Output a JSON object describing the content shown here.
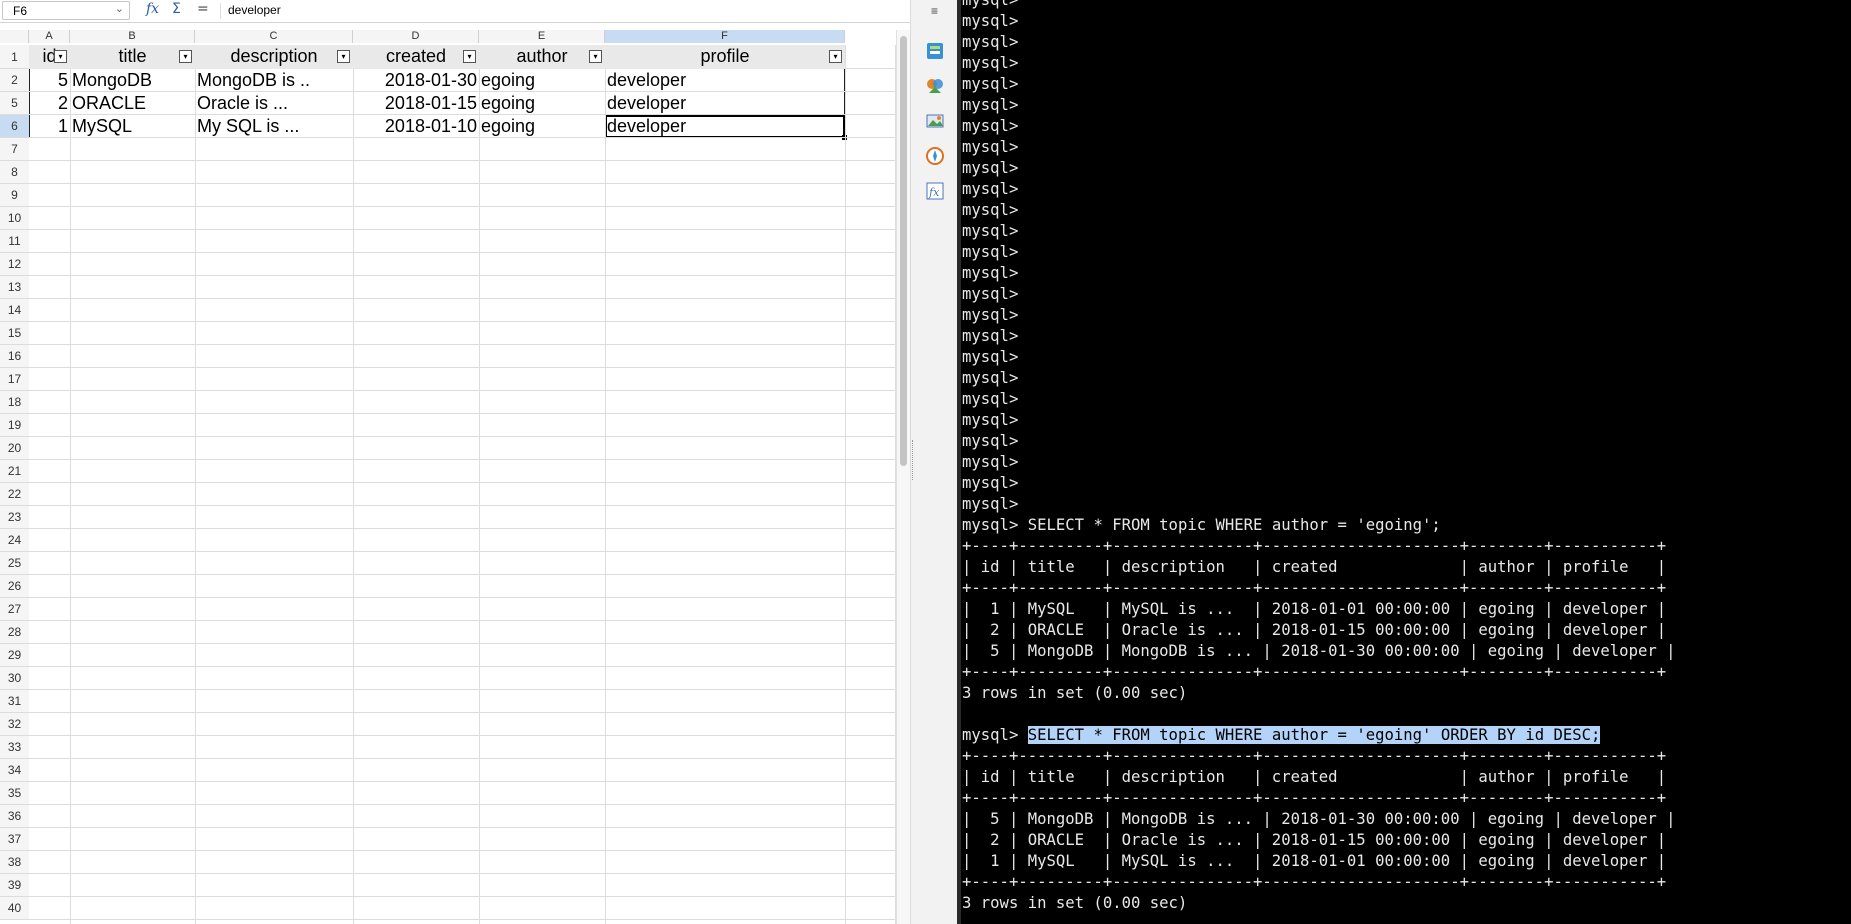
{
  "formula_bar": {
    "cell_ref": "F6",
    "value": "developer",
    "icons": [
      "function-wizard-icon",
      "sum-icon",
      "formula-equals-icon"
    ]
  },
  "columns": [
    "A",
    "B",
    "C",
    "D",
    "E",
    "F"
  ],
  "selected_column": "F",
  "row_numbers": [
    "1",
    "2",
    "5",
    "6",
    "7",
    "8",
    "9",
    "10",
    "11",
    "12",
    "13",
    "14",
    "15",
    "16",
    "17",
    "18",
    "19",
    "20",
    "21",
    "22",
    "23",
    "24",
    "25",
    "26",
    "27",
    "28",
    "29",
    "30",
    "31",
    "32",
    "33",
    "34",
    "35",
    "36",
    "37",
    "38",
    "39",
    "40"
  ],
  "selected_row": "6",
  "table": {
    "headers": [
      "id",
      "title",
      "description",
      "created",
      "author",
      "profile"
    ],
    "rows": [
      [
        "5",
        "MongoDB",
        "MongoDB is ..",
        "2018-01-30",
        "egoing",
        "developer"
      ],
      [
        "2",
        "ORACLE",
        "Oracle is ...",
        "2018-01-15",
        "egoing",
        "developer"
      ],
      [
        "1",
        "MySQL",
        "My SQL is ...",
        "2018-01-10",
        "egoing",
        "developer"
      ]
    ]
  },
  "sidebar": {
    "menu_icon": "hamburger-icon",
    "icons": [
      "properties-icon",
      "styles-icon",
      "gallery-icon",
      "navigator-icon",
      "functions-icon"
    ],
    "colors": [
      "#3b8fd6",
      "#e0852a",
      "#4a9d4a",
      "#e07020",
      "#4a74b8"
    ]
  },
  "terminal": {
    "prompt": "mysql>",
    "empty_prompt_count": 25,
    "query1": "SELECT * FROM topic WHERE author = 'egoing';",
    "query2": "SELECT * FROM topic WHERE author = 'egoing' ORDER BY id DESC;",
    "border": "+----+---------+---------------+---------------------+--------+-----------+",
    "header": "| id | title   | description   | created             | author | profile   |",
    "result1": [
      "|  1 | MySQL   | MySQL is ...  | 2018-01-01 00:00:00 | egoing | developer |",
      "|  2 | ORACLE  | Oracle is ... | 2018-01-15 00:00:00 | egoing | developer |",
      "|  5 | MongoDB | MongoDB is ... | 2018-01-30 00:00:00 | egoing | developer |"
    ],
    "result2": [
      "|  5 | MongoDB | MongoDB is ... | 2018-01-30 00:00:00 | egoing | developer |",
      "|  2 | ORACLE  | Oracle is ... | 2018-01-15 00:00:00 | egoing | developer |",
      "|  1 | MySQL   | MySQL is ...  | 2018-01-01 00:00:00 | egoing | developer |"
    ],
    "rows_in_set": "3 rows in set (0.00 sec)"
  }
}
